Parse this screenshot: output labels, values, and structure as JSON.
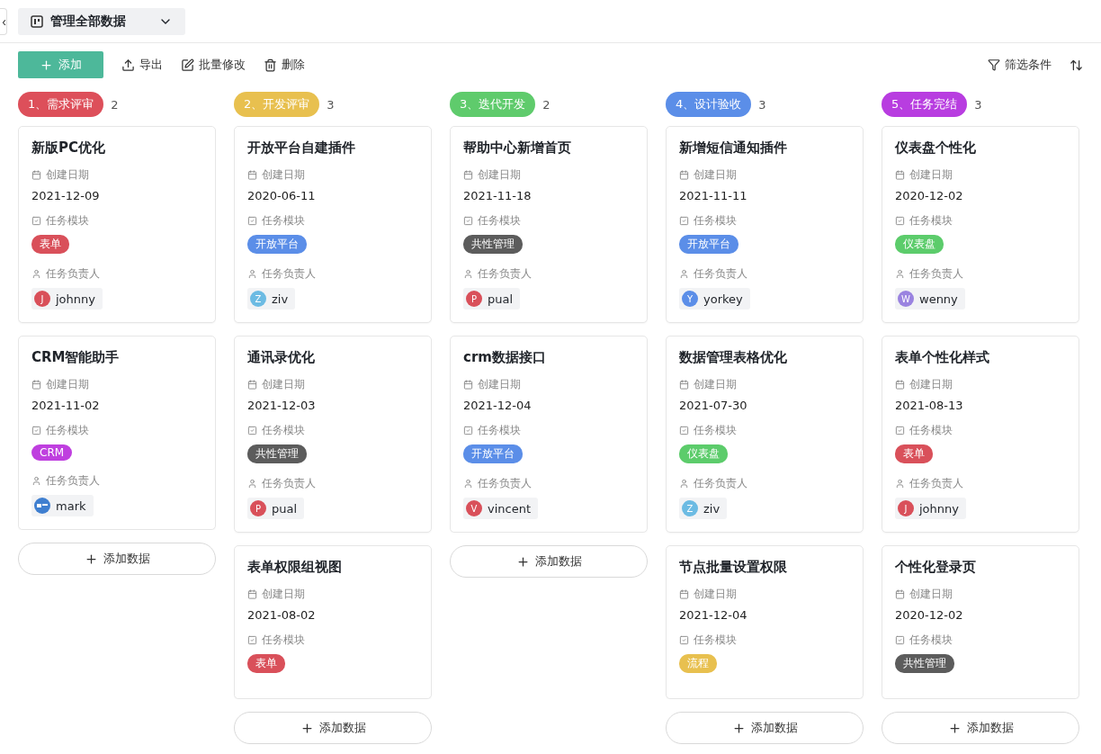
{
  "header": {
    "back": "‹",
    "view_title": "管理全部数据"
  },
  "toolbar": {
    "add": "添加",
    "actions": [
      {
        "kind": "export",
        "label": "导出"
      },
      {
        "kind": "edit",
        "label": "批量修改"
      },
      {
        "kind": "delete",
        "label": "删除"
      }
    ],
    "filter": "筛选条件"
  },
  "columns": [
    {
      "title": "1、需求评审",
      "count": "2",
      "color": "#dd4f5a",
      "add_button": "添加数据",
      "cards": [
        {
          "title": "新版PC优化",
          "date_label": "创建日期",
          "date": "2021-12-09",
          "module_label": "任务模块",
          "tag": {
            "label": "表单",
            "color": "#d9505a"
          },
          "owner_label": "任务负责人",
          "owner": {
            "name": "johnny",
            "initial": "J",
            "kind": "letter",
            "color": "#d9505a"
          }
        },
        {
          "title": "CRM智能助手",
          "date_label": "创建日期",
          "date": "2021-11-02",
          "module_label": "任务模块",
          "tag": {
            "label": "CRM",
            "color": "#bf3fdf"
          },
          "owner_label": "任务负责人",
          "owner": {
            "name": "mark",
            "kind": "logo",
            "color": "#3f7fd0"
          }
        }
      ]
    },
    {
      "title": "2、开发评审",
      "count": "3",
      "color": "#e8c04f",
      "add_button": "添加数据",
      "cards": [
        {
          "title": "开放平台自建插件",
          "date_label": "创建日期",
          "date": "2020-06-11",
          "module_label": "任务模块",
          "tag": {
            "label": "开放平台",
            "color": "#5b8ee8"
          },
          "owner_label": "任务负责人",
          "owner": {
            "name": "ziv",
            "initial": "Z",
            "kind": "letter",
            "color": "#6cbbe3"
          }
        },
        {
          "title": "通讯录优化",
          "date_label": "创建日期",
          "date": "2021-12-03",
          "module_label": "任务模块",
          "tag": {
            "label": "共性管理",
            "color": "#5c5c5c"
          },
          "owner_label": "任务负责人",
          "owner": {
            "name": "pual",
            "initial": "P",
            "kind": "letter",
            "color": "#d9505a"
          }
        },
        {
          "title": "表单权限组视图",
          "date_label": "创建日期",
          "date": "2021-08-02",
          "module_label": "任务模块",
          "tag": {
            "label": "表单",
            "color": "#d9505a"
          }
        }
      ]
    },
    {
      "title": "3、迭代开发",
      "count": "2",
      "color": "#5fcb6c",
      "add_button": "添加数据",
      "cards": [
        {
          "title": "帮助中心新增首页",
          "date_label": "创建日期",
          "date": "2021-11-18",
          "module_label": "任务模块",
          "tag": {
            "label": "共性管理",
            "color": "#5c5c5c"
          },
          "owner_label": "任务负责人",
          "owner": {
            "name": "pual",
            "initial": "P",
            "kind": "letter",
            "color": "#d9505a"
          }
        },
        {
          "title": "crm数据接口",
          "date_label": "创建日期",
          "date": "2021-12-04",
          "module_label": "任务模块",
          "tag": {
            "label": "开放平台",
            "color": "#5b8ee8"
          },
          "owner_label": "任务负责人",
          "owner": {
            "name": "vincent",
            "initial": "V",
            "kind": "letter",
            "color": "#d9505a"
          }
        }
      ]
    },
    {
      "title": "4、设计验收",
      "count": "3",
      "color": "#5b8ee8",
      "add_button": "添加数据",
      "cards": [
        {
          "title": "新增短信通知插件",
          "date_label": "创建日期",
          "date": "2021-11-11",
          "module_label": "任务模块",
          "tag": {
            "label": "开放平台",
            "color": "#5b8ee8"
          },
          "owner_label": "任务负责人",
          "owner": {
            "name": "yorkey",
            "initial": "Y",
            "kind": "letter",
            "color": "#5b8ee8"
          }
        },
        {
          "title": "数据管理表格优化",
          "date_label": "创建日期",
          "date": "2021-07-30",
          "module_label": "任务模块",
          "tag": {
            "label": "仪表盘",
            "color": "#5ccc6b"
          },
          "owner_label": "任务负责人",
          "owner": {
            "name": "ziv",
            "initial": "Z",
            "kind": "letter",
            "color": "#6cbbe3"
          }
        },
        {
          "title": "节点批量设置权限",
          "date_label": "创建日期",
          "date": "2021-12-04",
          "module_label": "任务模块",
          "tag": {
            "label": "流程",
            "color": "#e8c04f"
          }
        }
      ]
    },
    {
      "title": "5、任务完结",
      "count": "3",
      "color": "#b83de0",
      "add_button": "添加数据",
      "cards": [
        {
          "title": "仪表盘个性化",
          "date_label": "创建日期",
          "date": "2020-12-02",
          "module_label": "任务模块",
          "tag": {
            "label": "仪表盘",
            "color": "#5ccc6b"
          },
          "owner_label": "任务负责人",
          "owner": {
            "name": "wenny",
            "initial": "W",
            "kind": "letter",
            "color": "#9a83e0"
          }
        },
        {
          "title": "表单个性化样式",
          "date_label": "创建日期",
          "date": "2021-08-13",
          "module_label": "任务模块",
          "tag": {
            "label": "表单",
            "color": "#d9505a"
          },
          "owner_label": "任务负责人",
          "owner": {
            "name": "johnny",
            "initial": "J",
            "kind": "letter",
            "color": "#d9505a"
          }
        },
        {
          "title": "个性化登录页",
          "date_label": "创建日期",
          "date": "2020-12-02",
          "module_label": "任务模块",
          "tag": {
            "label": "共性管理",
            "color": "#5c5c5c"
          }
        }
      ]
    }
  ]
}
